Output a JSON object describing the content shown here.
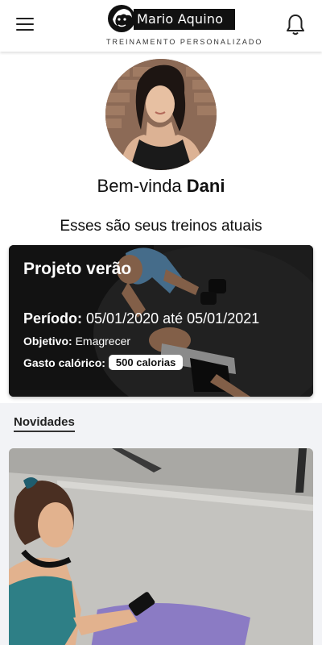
{
  "header": {
    "logo_text": "Mario Aquino",
    "logo_subtitle": "TREINAMENTO PERSONALIZADO"
  },
  "profile": {
    "greeting": "Bem-vinda",
    "name": "Dani",
    "current_workouts_title": "Esses são seus treinos atuais"
  },
  "workout_card": {
    "title": "Projeto verão",
    "period_label": "Período:",
    "period_value": "05/01/2020 até 05/01/2021",
    "objective_label": "Objetivo:",
    "objective_value": "Emagrecer",
    "calories_label": "Gasto calórico:",
    "calories_value": "500 calorias"
  },
  "news": {
    "section_title": "Novidades"
  }
}
